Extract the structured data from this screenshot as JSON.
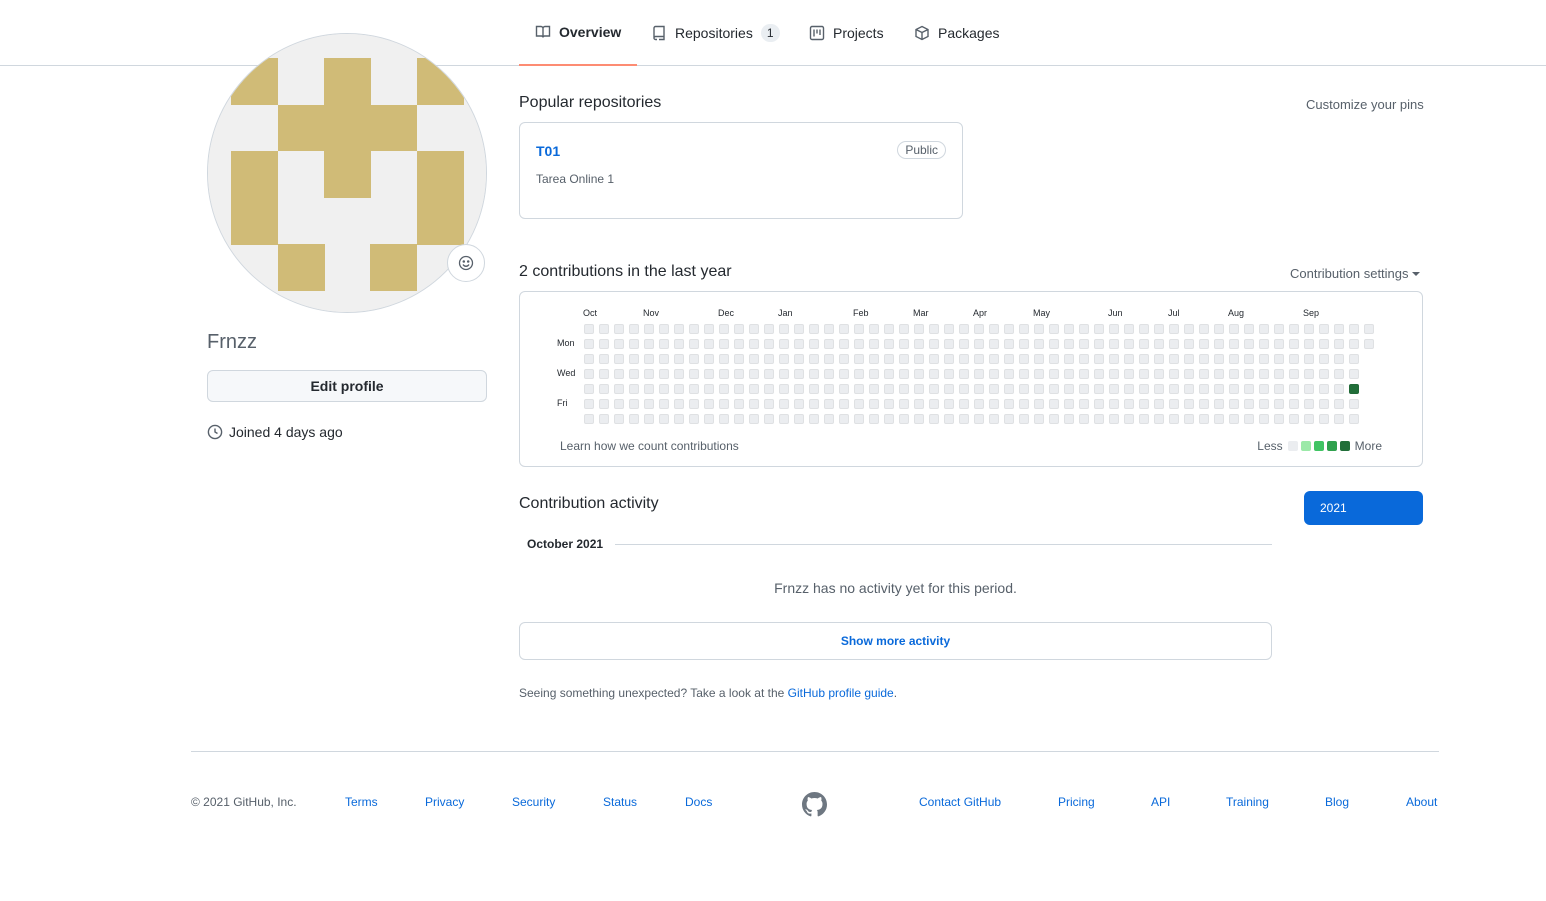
{
  "nav": {
    "tabs": [
      {
        "label": "Overview",
        "icon": "book-icon",
        "active": true
      },
      {
        "label": "Repositories",
        "icon": "repo-icon",
        "count": "1"
      },
      {
        "label": "Projects",
        "icon": "project-icon"
      },
      {
        "label": "Packages",
        "icon": "package-icon"
      }
    ]
  },
  "profile": {
    "username": "Frnzz",
    "edit_label": "Edit profile",
    "joined": "Joined 4 days ago",
    "avatar_color": "#d0bb77",
    "avatar_bg": "#f0f0f0"
  },
  "popular": {
    "title": "Popular repositories",
    "customize": "Customize your pins",
    "repos": [
      {
        "name": "T01",
        "visibility": "Public",
        "description": "Tarea Online 1"
      }
    ]
  },
  "contributions": {
    "title": "2 contributions in the last year",
    "settings": "Contribution settings",
    "months": [
      "Oct",
      "Nov",
      "Dec",
      "Jan",
      "Feb",
      "Mar",
      "Apr",
      "May",
      "Jun",
      "Jul",
      "Aug",
      "Sep"
    ],
    "days": [
      "Mon",
      "Wed",
      "Fri"
    ],
    "learn": "Learn how we count contributions",
    "less": "Less",
    "more": "More",
    "levels": [
      "#ebedf0",
      "#9be9a8",
      "#40c463",
      "#30a14e",
      "#216e39"
    ],
    "weeks": 53,
    "last_week_days": 2,
    "active_cells": [
      {
        "week": 51,
        "day": 4,
        "level": 4
      }
    ]
  },
  "activity": {
    "title": "Contribution activity",
    "year": "2021",
    "period": "October 2021",
    "empty": "Frnzz has no activity yet for this period.",
    "show_more": "Show more activity",
    "hint_text": "Seeing something unexpected? Take a look at the",
    "hint_link": "GitHub profile guide",
    "hint_end": "."
  },
  "footer": {
    "copyright": "© 2021 GitHub, Inc.",
    "left_links": [
      "Terms",
      "Privacy",
      "Security",
      "Status",
      "Docs"
    ],
    "right_links": [
      "Contact GitHub",
      "Pricing",
      "API",
      "Training",
      "Blog",
      "About"
    ]
  }
}
